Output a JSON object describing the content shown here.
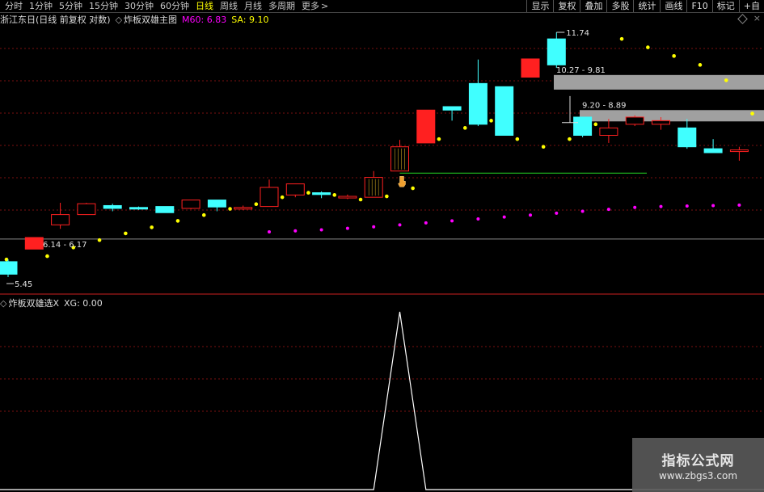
{
  "toolbar": {
    "periods": [
      "分时",
      "1分钟",
      "5分钟",
      "15分钟",
      "30分钟",
      "60分钟",
      "日线",
      "周线",
      "月线",
      "多周期",
      "更多"
    ],
    "active_period": "日线",
    "more_arrow": ">",
    "right_buttons": [
      "显示",
      "复权",
      "叠加",
      "多股",
      "统计",
      "画线",
      "F10",
      "标记",
      "+自"
    ]
  },
  "main_panel": {
    "title": "浙江东日(日线 前复权 对数)",
    "indicator_icon": "◇",
    "indicator_name": "炸板双雄主图",
    "m60_label": "M60: 6.83",
    "sa_label": "SA: 9.10",
    "close_glyph": "×",
    "colors": {
      "up": "#ff2020",
      "down": "#40ffff",
      "m60": "#ff00ff",
      "sa": "#ffff00",
      "grid": "#7a1010",
      "line_green": "#20c020",
      "zone": "#a0a0a0",
      "axis": "#cc2020"
    }
  },
  "sub_panel": {
    "indicator_icon": "◇",
    "title": "炸板双雄选X",
    "xg_label": "XG: 0.00"
  },
  "watermark": {
    "title": "指标公式网",
    "url": "www.zbgs3.com"
  },
  "chart_data": {
    "type": "candlestick",
    "scale": "log",
    "candles": [
      {
        "o": 5.72,
        "c": 5.5,
        "h": 5.76,
        "l": 5.45,
        "sa": 5.76,
        "m60": null
      },
      {
        "o": 5.95,
        "c": 6.17,
        "h": 6.17,
        "l": 5.95,
        "sa": 5.82,
        "m60": null
      },
      {
        "o": 6.42,
        "c": 6.63,
        "h": 6.88,
        "l": 6.34,
        "sa": 5.98,
        "m60": null
      },
      {
        "o": 6.63,
        "c": 6.86,
        "h": 6.88,
        "l": 6.63,
        "sa": 6.12,
        "m60": null
      },
      {
        "o": 6.82,
        "c": 6.76,
        "h": 6.86,
        "l": 6.7,
        "sa": 6.25,
        "m60": null
      },
      {
        "o": 6.78,
        "c": 6.75,
        "h": 6.8,
        "l": 6.73,
        "sa": 6.37,
        "m60": null
      },
      {
        "o": 6.8,
        "c": 6.67,
        "h": 6.8,
        "l": 6.67,
        "sa": 6.5,
        "m60": null
      },
      {
        "o": 6.76,
        "c": 6.94,
        "h": 6.94,
        "l": 6.74,
        "sa": 6.62,
        "m60": null
      },
      {
        "o": 6.94,
        "c": 6.79,
        "h": 6.94,
        "l": 6.7,
        "sa": 6.75,
        "m60": null
      },
      {
        "o": 6.75,
        "c": 6.78,
        "h": 6.82,
        "l": 6.73,
        "sa": 6.85,
        "m60": null
      },
      {
        "o": 6.8,
        "c": 7.22,
        "h": 7.4,
        "l": 6.8,
        "sa": 7.0,
        "m60": 6.28
      },
      {
        "o": 7.05,
        "c": 7.3,
        "h": 7.3,
        "l": 7.0,
        "sa": 7.1,
        "m60": 6.3
      },
      {
        "o": 7.1,
        "c": 7.06,
        "h": 7.13,
        "l": 6.98,
        "sa": 7.05,
        "m60": 6.32
      },
      {
        "o": 7.0,
        "c": 7.02,
        "h": 7.06,
        "l": 6.96,
        "sa": 6.95,
        "m60": 6.35
      },
      {
        "o": 7.0,
        "c": 7.45,
        "h": 7.6,
        "l": 7.0,
        "sa": 7.02,
        "m60": 6.38
      },
      {
        "o": 7.6,
        "c": 8.2,
        "h": 8.38,
        "l": 7.6,
        "sa": 7.2,
        "m60": 6.42
      },
      {
        "o": 8.3,
        "c": 9.2,
        "h": 9.2,
        "l": 8.3,
        "sa": 8.4,
        "m60": 6.46
      },
      {
        "o": 9.3,
        "c": 9.2,
        "h": 9.3,
        "l": 8.9,
        "sa": 8.7,
        "m60": 6.5
      },
      {
        "o": 10.0,
        "c": 8.8,
        "h": 10.78,
        "l": 8.75,
        "sa": 8.9,
        "m60": 6.54
      },
      {
        "o": 9.9,
        "c": 8.5,
        "h": 9.9,
        "l": 8.5,
        "sa": 8.4,
        "m60": 6.58
      },
      {
        "o": 10.2,
        "c": 10.8,
        "h": 10.8,
        "l": 10.2,
        "sa": 8.2,
        "m60": 6.62
      },
      {
        "o": 11.5,
        "c": 10.6,
        "h": 11.74,
        "l": 10.5,
        "sa": 8.4,
        "m60": 6.66
      },
      {
        "o": 9.0,
        "c": 8.5,
        "h": 9.0,
        "l": 8.45,
        "sa": 8.8,
        "m60": 6.7
      },
      {
        "o": 8.5,
        "c": 8.7,
        "h": 8.95,
        "l": 8.3,
        "sa": 11.5,
        "m60": 6.74
      },
      {
        "o": 8.8,
        "c": 9.0,
        "h": 9.05,
        "l": 8.75,
        "sa": 11.2,
        "m60": 6.78
      },
      {
        "o": 8.8,
        "c": 8.9,
        "h": 9.0,
        "l": 8.65,
        "sa": 10.9,
        "m60": 6.8
      },
      {
        "o": 8.7,
        "c": 8.2,
        "h": 8.95,
        "l": 8.15,
        "sa": 10.6,
        "m60": 6.81
      },
      {
        "o": 8.15,
        "c": 8.05,
        "h": 8.4,
        "l": 8.05,
        "sa": 10.1,
        "m60": 6.82
      },
      {
        "o": 8.1,
        "c": 8.12,
        "h": 8.2,
        "l": 7.85,
        "sa": 9.1,
        "m60": 6.83
      }
    ],
    "annotations": [
      {
        "text": "11.74",
        "kind": "high"
      },
      {
        "text": "10.27 - 9.81",
        "kind": "zone",
        "lo": 9.81,
        "hi": 10.27
      },
      {
        "text": "9.20 - 8.89",
        "kind": "zone",
        "lo": 8.89,
        "hi": 9.2
      },
      {
        "text": "6.14 - 6.17",
        "kind": "label"
      },
      {
        "text": "5.45",
        "kind": "low"
      }
    ],
    "support_line": 7.55,
    "base_line": 6.14,
    "xg_signal_index": 15
  }
}
